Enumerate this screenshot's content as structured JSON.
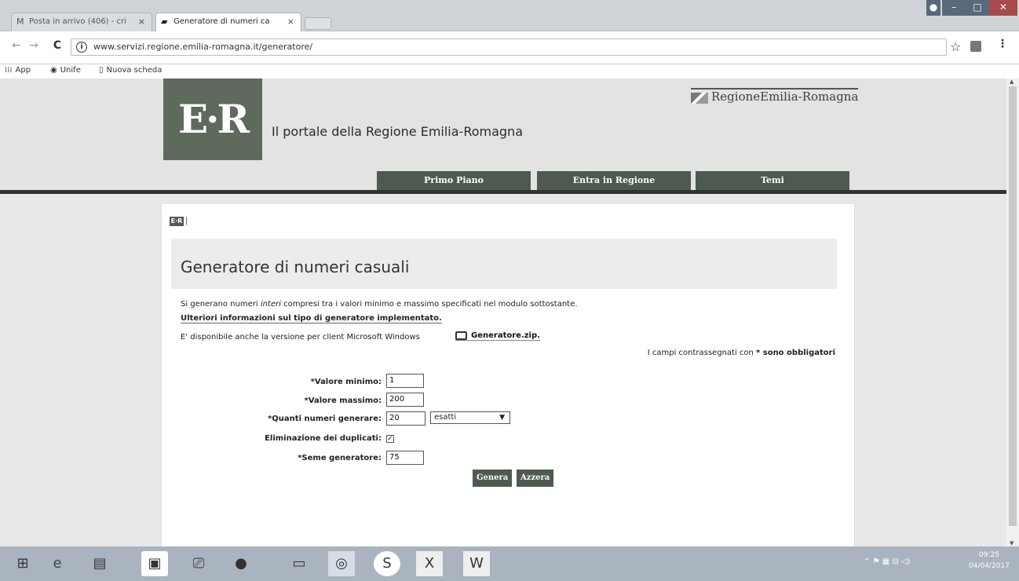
{
  "browser": {
    "tabs": [
      {
        "label": "Posta in arrivo (406) - cri",
        "icon": "gmail-icon"
      },
      {
        "label": "Generatore di numeri ca",
        "icon": "er-favicon-icon"
      }
    ],
    "close_glyph": "×",
    "url": "www.servizi.regione.emilia-romagna.it/generatore/",
    "bookmarks": [
      {
        "label": "App",
        "icon": "apps-grid-icon"
      },
      {
        "label": "Unife",
        "icon": "unife-icon"
      },
      {
        "label": "Nuova scheda",
        "icon": "page-icon"
      }
    ]
  },
  "header": {
    "logo_text": "E·R",
    "portal_title": "Il portale della Regione Emilia-Romagna",
    "region_logo": "RegioneEmilia-Romagna",
    "nav": [
      "Primo Piano",
      "Entra in Regione",
      "Temi"
    ]
  },
  "content": {
    "breadcrumb_logo": "E·R",
    "breadcrumb_sep": "|",
    "title": "Generatore di numeri casuali",
    "desc_before": "Si generano numeri ",
    "desc_em": "interi",
    "desc_after": " compresi tra i valori minimo e massimo specificati nel modulo sottostante.",
    "more_link": "Ulteriori informazioni sul tipo di generatore implementato.",
    "client_line": "E' disponibile anche la versione per client Microsoft Windows",
    "zip_link": "Generatore.zip.",
    "required_note_before": "I campi contrassegnati con ",
    "required_note_bold": "* sono obbligatori"
  },
  "form": {
    "min_label": "*Valore minimo:",
    "min_value": "1",
    "max_label": "*Valore massimo:",
    "max_value": "200",
    "count_label": "*Quanti numeri generare:",
    "count_value": "20",
    "count_mode": "esatti",
    "dedup_label": "Eliminazione dei duplicati:",
    "dedup_checked": true,
    "seed_label": "*Seme generatore:",
    "seed_value": "75",
    "generate_label": "Genera",
    "reset_label": "Azzera"
  },
  "taskbar": {
    "clock_time": "09:25",
    "clock_date": "04/04/2017",
    "apps": [
      "windows-start-icon",
      "internet-explorer-icon",
      "file-manager-icon",
      "store-icon",
      "remote-desktop-icon",
      "media-player-icon",
      "file-explorer-icon",
      "chrome-icon",
      "skype-icon",
      "excel-icon",
      "word-icon"
    ]
  },
  "colors": {
    "nav_green": "#4e5a4f",
    "logo_green": "#5d6a5c"
  }
}
